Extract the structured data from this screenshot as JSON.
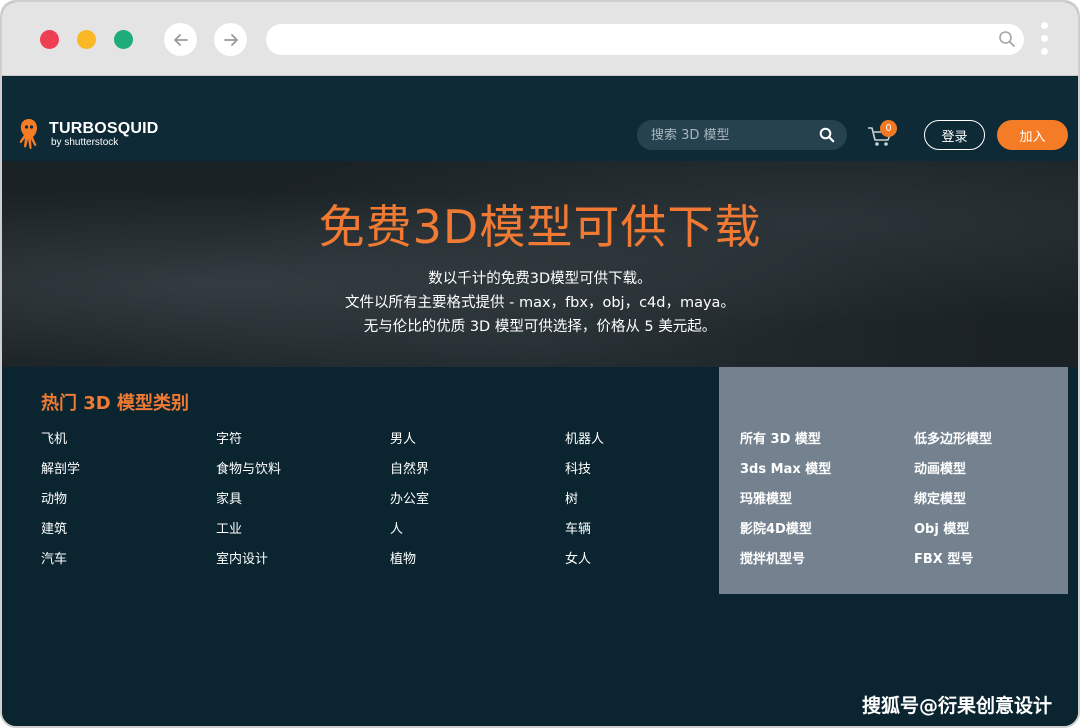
{
  "site": {
    "logo_title": "TURBOSQUID",
    "logo_sub": "by shutterstock",
    "search_placeholder": "搜索 3D 模型",
    "cart_count": "0",
    "login_label": "登录",
    "join_label": "加入"
  },
  "hero": {
    "title": "免费3D模型可供下载",
    "line1": "数以千计的免费3D模型可供下载。",
    "line2": "文件以所有主要格式提供 - max，fbx，obj，c4d，maya。",
    "line3": "无与伦比的优质 3D 模型可供选择，价格从 5 美元起。"
  },
  "categories": {
    "heading": "热门 3D 模型类别",
    "col1": [
      "飞机",
      "解剖学",
      "动物",
      "建筑",
      "汽车"
    ],
    "col2": [
      "字符",
      "食物与饮料",
      "家具",
      "工业",
      "室内设计"
    ],
    "col3": [
      "男人",
      "自然界",
      "办公室",
      "人",
      "植物"
    ],
    "col4": [
      "机器人",
      "科技",
      "树",
      "车辆",
      "女人"
    ],
    "formats_col1": [
      "所有 3D 模型",
      "3ds Max 模型",
      "玛雅模型",
      "影院4D模型",
      "搅拌机型号"
    ],
    "formats_col2": [
      "低多边形模型",
      "动画模型",
      "绑定模型",
      "Obj 模型",
      "FBX 型号"
    ]
  },
  "watermark": "搜狐号@衍果创意设计",
  "colors": {
    "accent_orange": "#f57c27",
    "header_bg": "#0d2a36",
    "panel_bg": "#748290",
    "page_bg": "#0a2530"
  },
  "icons": {
    "back": "arrow-left-icon",
    "forward": "arrow-right-icon",
    "url_search": "search-icon",
    "menu": "kebab-menu-icon",
    "logo": "squid-logo-icon",
    "site_search": "search-icon",
    "cart": "cart-icon"
  }
}
